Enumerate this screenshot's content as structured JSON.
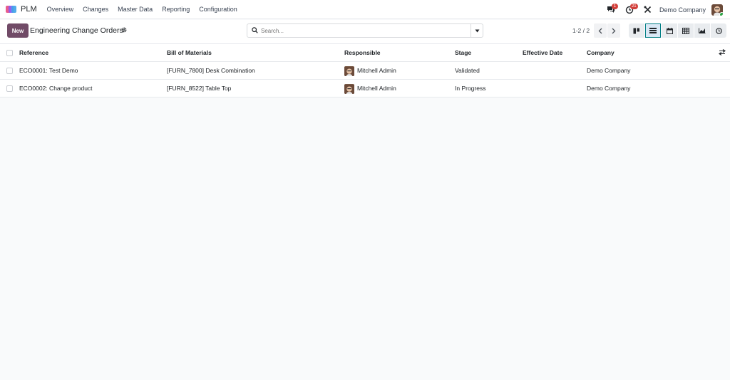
{
  "navbar": {
    "app_name": "PLM",
    "menu": [
      "Overview",
      "Changes",
      "Master Data",
      "Reporting",
      "Configuration"
    ],
    "messages_badge": "1",
    "activities_badge": "21",
    "company": "Demo Company"
  },
  "control": {
    "new_label": "New",
    "title": "Engineering Change Orders",
    "search_placeholder": "Search...",
    "pager": "1-2 / 2",
    "views": [
      "kanban-icon",
      "list-icon",
      "calendar-icon",
      "pivot-icon",
      "graph-icon",
      "activity-icon"
    ],
    "active_view": "list-icon"
  },
  "table": {
    "columns": {
      "reference": "Reference",
      "bom": "Bill of Materials",
      "responsible": "Responsible",
      "stage": "Stage",
      "effective_date": "Effective Date",
      "company": "Company"
    },
    "rows": [
      {
        "reference": "ECO0001: Test Demo",
        "bom": "[FURN_7800] Desk Combination",
        "responsible": "Mitchell Admin",
        "stage": "Validated",
        "effective_date": "",
        "company": "Demo Company"
      },
      {
        "reference": "ECO0002: Change product",
        "bom": "[FURN_8522] Table Top",
        "responsible": "Mitchell Admin",
        "stage": "In Progress",
        "effective_date": "",
        "company": "Demo Company"
      }
    ]
  },
  "colors": {
    "brand": "#714b67",
    "active_view_border": "#017e84",
    "badge": "#d23f3a"
  }
}
